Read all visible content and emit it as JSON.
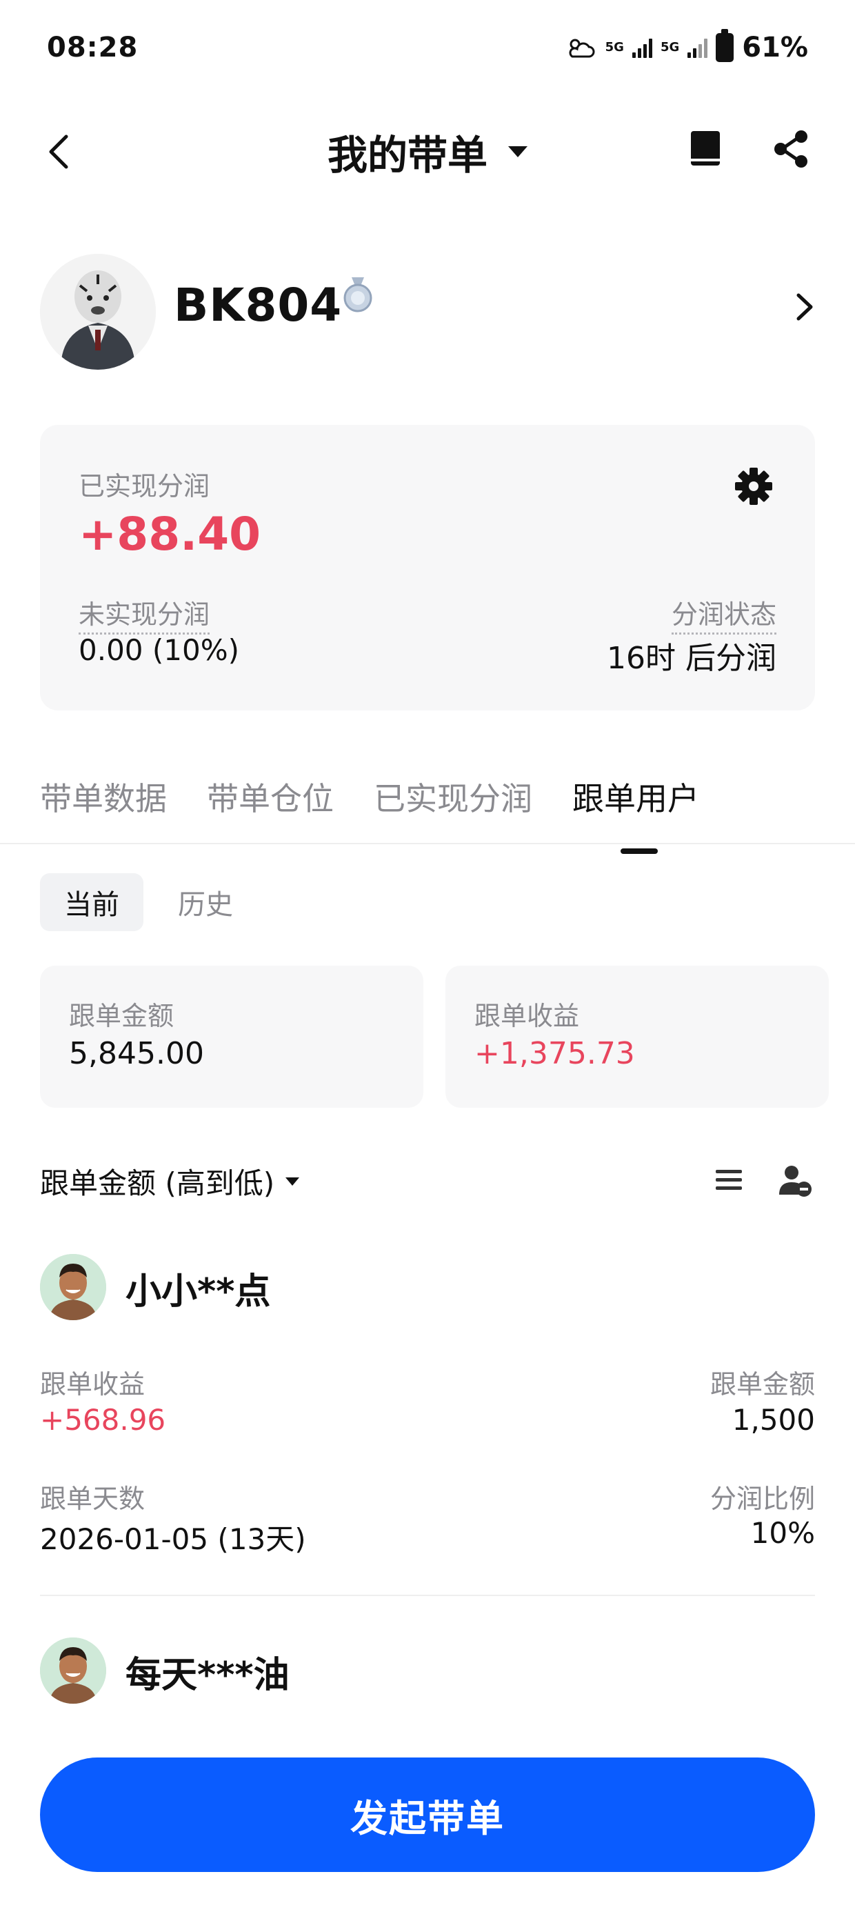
{
  "status_bar": {
    "time": "08:28",
    "net1": "5G",
    "net2": "5G",
    "battery": "61%"
  },
  "header": {
    "title": "我的带单"
  },
  "profile": {
    "name": "BK804"
  },
  "summary": {
    "realized_label": "已实现分润",
    "realized_value": "+88.40",
    "unrealized_label": "未实现分润",
    "unrealized_value": "0.00 (10%)",
    "status_label": "分润状态",
    "status_value": "16时 后分润"
  },
  "tabs": [
    {
      "label": "带单数据",
      "active": false
    },
    {
      "label": "带单仓位",
      "active": false
    },
    {
      "label": "已实现分润",
      "active": false
    },
    {
      "label": "跟单用户",
      "active": true
    }
  ],
  "segment": {
    "current": "当前",
    "history": "历史"
  },
  "stats": {
    "amount_label": "跟单金额",
    "amount_value": "5,845.00",
    "profit_label": "跟单收益",
    "profit_value": "+1,375.73"
  },
  "sort": {
    "label": "跟单金额 (高到低)"
  },
  "followers": [
    {
      "name": "小小**点",
      "profit_label": "跟单收益",
      "profit_value": "+568.96",
      "amount_label": "跟单金额",
      "amount_value": "1,500",
      "days_label": "跟单天数",
      "days_value": "2026-01-05 (13天)",
      "ratio_label": "分润比例",
      "ratio_value": "10%"
    },
    {
      "name": "每天***油"
    }
  ],
  "cta": {
    "label": "发起带单"
  },
  "colors": {
    "accent": "#0a5cff",
    "profit": "#e8455d",
    "muted": "#8a8a8f"
  },
  "icons": [
    "back-icon",
    "caret-down-icon",
    "book-icon",
    "share-icon",
    "medal-icon",
    "chevron-right-icon",
    "gear-icon",
    "list-icon",
    "user-remove-icon"
  ]
}
